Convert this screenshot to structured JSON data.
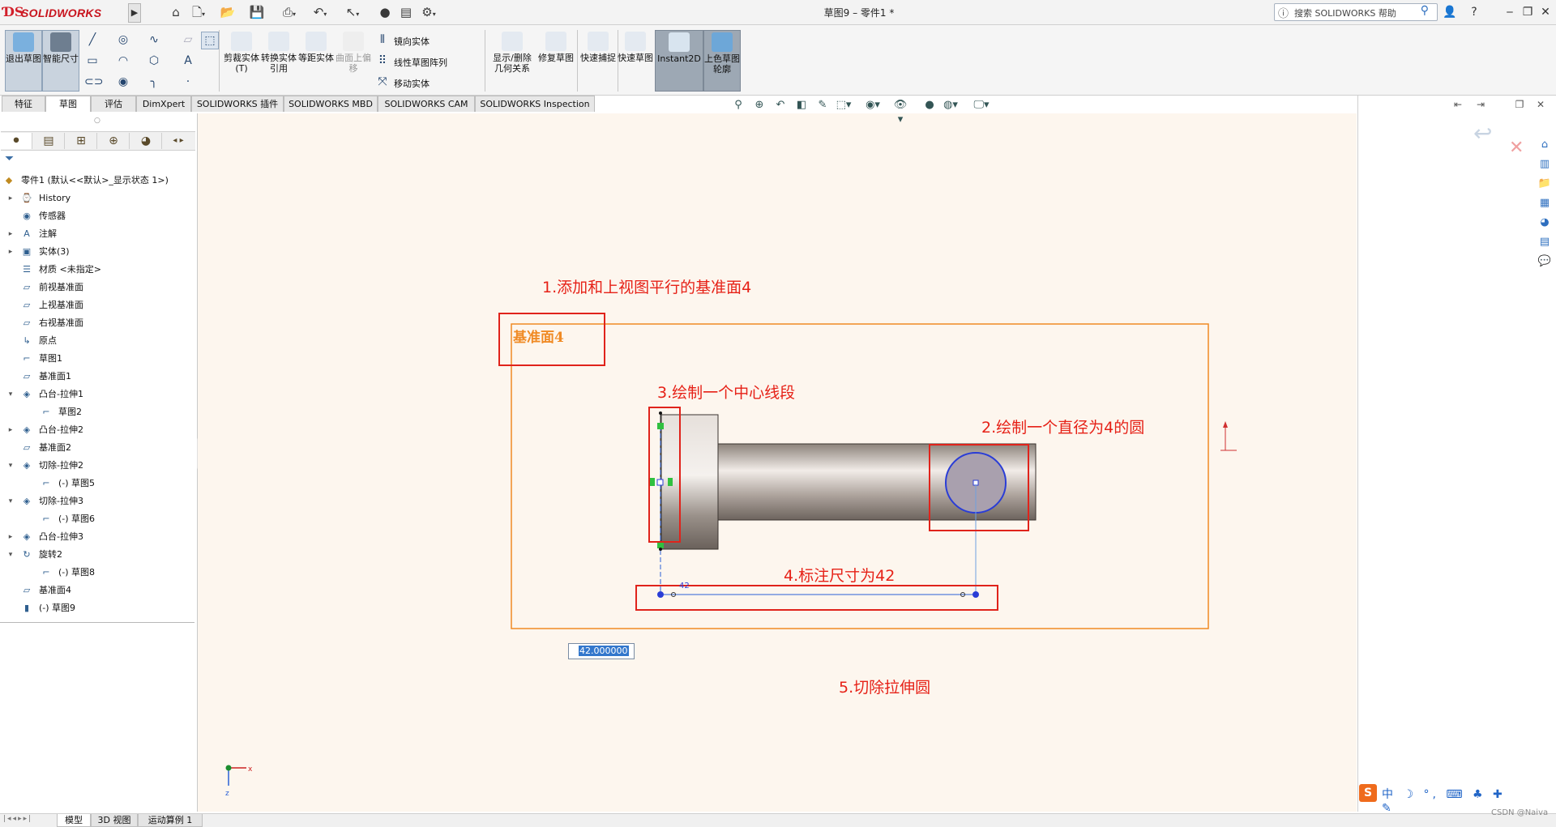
{
  "app": {
    "brand": "SOLIDWORKS",
    "doc_title": "草图9 – 零件1 *",
    "search_placeholder": "搜索 SOLIDWORKS 帮助"
  },
  "ribbon": {
    "exit_sketch": "退出草图",
    "smart_dim": "智能尺寸",
    "trim": "剪裁实体(T)",
    "convert": "转换实体引用",
    "offset": "等距实体",
    "surface_offset": "曲面上偏移",
    "mirror": "镜向实体",
    "linear_pattern": "线性草图阵列",
    "move": "移动实体",
    "display_delete": "显示/删除几何关系",
    "repair": "修复草图",
    "quick_snap": "快速捕捉",
    "rapid_sketch": "快速草图",
    "instant2d": "Instant2D",
    "shaded_contours": "上色草图轮廓"
  },
  "tabs": [
    "特征",
    "草图",
    "评估",
    "DimXpert",
    "SOLIDWORKS 插件",
    "SOLIDWORKS MBD",
    "SOLIDWORKS CAM",
    "SOLIDWORKS Inspection"
  ],
  "tree": {
    "root": "零件1 (默认<<默认>_显示状态 1>)",
    "items": [
      {
        "label": "History"
      },
      {
        "label": "传感器"
      },
      {
        "label": "注解"
      },
      {
        "label": "实体(3)"
      },
      {
        "label": "材质 <未指定>"
      },
      {
        "label": "前视基准面"
      },
      {
        "label": "上视基准面"
      },
      {
        "label": "右视基准面"
      },
      {
        "label": "原点"
      },
      {
        "label": "草图1"
      },
      {
        "label": "基准面1"
      },
      {
        "label": "凸台-拉伸1"
      },
      {
        "label": "草图2"
      },
      {
        "label": "凸台-拉伸2"
      },
      {
        "label": "基准面2"
      },
      {
        "label": "切除-拉伸2"
      },
      {
        "label": "(-) 草图5"
      },
      {
        "label": "切除-拉伸3"
      },
      {
        "label": "(-) 草图6"
      },
      {
        "label": "凸台-拉伸3"
      },
      {
        "label": "旋转2"
      },
      {
        "label": "(-) 草图8"
      },
      {
        "label": "基准面4"
      },
      {
        "label": "(-) 草图9"
      }
    ]
  },
  "graphics": {
    "plane_label": "基准面4",
    "dimension_value": "42.000000",
    "dim_tag": "42"
  },
  "annotations": {
    "step1": "1.添加和上视图平行的基准面4",
    "step2": "2.绘制一个直径为4的圆",
    "step3": "3.绘制一个中心线段",
    "step4": "4.标注尺寸为42",
    "step5": "5.切除拉伸圆"
  },
  "bottom_tabs": [
    "模型",
    "3D 视图",
    "运动算例 1"
  ],
  "ime": {
    "text": "中 ☽ °, ⌨ ♣ ✚ ✎"
  },
  "watermark": "CSDN @Naiva",
  "colors": {
    "viewport_bg": "#fdf6ee",
    "plane_border": "#f08a24",
    "annotation_red": "#e62117",
    "sketch_blue": "#2a3dd6",
    "solidworks_red": "#c8141e"
  }
}
